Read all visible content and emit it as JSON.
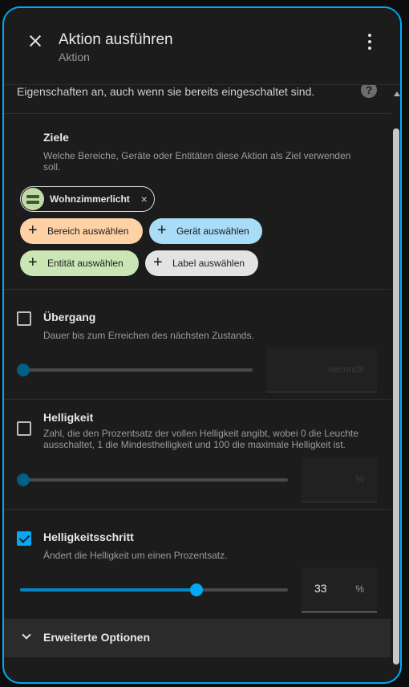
{
  "dialog": {
    "title": "Aktion ausführen",
    "subtitle": "Aktion"
  },
  "top_description": "Eigenschaften an, auch wenn sie bereits eingeschaltet sind.",
  "help_icon_glyph": "?",
  "targets": {
    "title": "Ziele",
    "description": "Welche Bereiche, Geräte oder Entitäten diese Aktion als Ziel verwenden soll.",
    "entity_chip": "Wohnzimmerlicht",
    "chip_remove_glyph": "×",
    "buttons": {
      "area": "Bereich auswählen",
      "device": "Gerät auswählen",
      "entity": "Entität auswählen",
      "label": "Label auswählen"
    },
    "plus_glyph": "+"
  },
  "transition": {
    "title": "Übergang",
    "description": "Dauer bis zum Erreichen des nächsten Zustands.",
    "unit": "seconds",
    "checked": false
  },
  "brightness": {
    "title": "Helligkeit",
    "description": "Zahl, die den Prozentsatz der vollen Helligkeit angibt, wobei 0 die Leuchte ausschaltet, 1 die Mindesthelligkeit und 100 die maximale Helligkeit ist.",
    "unit": "%",
    "checked": false
  },
  "brightness_step": {
    "title": "Helligkeitsschritt",
    "description": "Ändert die Helligkeit um einen Prozentsatz.",
    "value": "33",
    "unit": "%",
    "checked": true,
    "slider_fraction": 0.66
  },
  "advanced": {
    "label": "Erweiterte Optionen"
  },
  "colors": {
    "accent": "#03a9f4",
    "area_button": "#ffd2a6",
    "device_button": "#a8dcf7",
    "entity_button": "#c9e6b4",
    "label_button": "#e3e3e3"
  }
}
